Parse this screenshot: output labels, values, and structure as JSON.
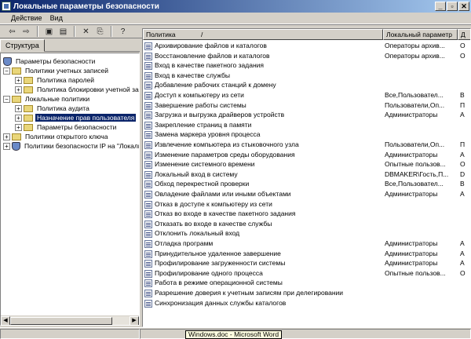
{
  "window": {
    "title": "Локальные параметры безопасности",
    "icon": "mmc-app-icon",
    "buttons": {
      "minimize": "_",
      "restore": "▫",
      "close": "✕"
    }
  },
  "menu": {
    "items": [
      "Действие",
      "Вид"
    ]
  },
  "toolbar": {
    "buttons": [
      {
        "name": "back-icon",
        "glyph": "⇦"
      },
      {
        "name": "forward-icon",
        "glyph": "⇨"
      },
      {
        "name": "up-folder-icon",
        "glyph": "▣"
      },
      {
        "name": "show-tree-icon",
        "glyph": "▤"
      },
      {
        "name": "delete-icon",
        "glyph": "✕"
      },
      {
        "name": "export-list-icon",
        "glyph": "⎘"
      },
      {
        "name": "help-icon",
        "glyph": "?"
      }
    ]
  },
  "left_pane": {
    "tab": "Структура",
    "tree": [
      {
        "label": "Параметры безопасности",
        "level": 0,
        "icon": "security-shield-icon",
        "toggle": ""
      },
      {
        "label": "Политики учетных записей",
        "level": 1,
        "icon": "folder-icon",
        "toggle": "−"
      },
      {
        "label": "Политика паролей",
        "level": 2,
        "icon": "folder-icon",
        "toggle": "+"
      },
      {
        "label": "Политика блокировки учетной зап",
        "level": 2,
        "icon": "folder-icon",
        "toggle": "+"
      },
      {
        "label": "Локальные политики",
        "level": 1,
        "icon": "folder-icon",
        "toggle": "−"
      },
      {
        "label": "Политика аудита",
        "level": 2,
        "icon": "folder-icon",
        "toggle": "+"
      },
      {
        "label": "Назначение прав пользователя",
        "level": 2,
        "icon": "folder-icon",
        "toggle": "+",
        "selected": true
      },
      {
        "label": "Параметры безопасности",
        "level": 2,
        "icon": "folder-icon",
        "toggle": "+"
      },
      {
        "label": "Политики открытого ключа",
        "level": 1,
        "icon": "folder-icon",
        "toggle": "+"
      },
      {
        "label": "Политики безопасности IP на \"Локаль",
        "level": 1,
        "icon": "ip-security-icon",
        "toggle": "+"
      }
    ]
  },
  "list": {
    "columns": [
      "Политика",
      "Локальный параметр",
      "Д"
    ],
    "sort_arrow": "/",
    "rows": [
      [
        "Архивирование файлов и каталогов",
        "Операторы архив...",
        "О"
      ],
      [
        "Восстановление файлов и каталогов",
        "Операторы архив...",
        "О"
      ],
      [
        "Вход в качестве пакетного задания",
        "",
        ""
      ],
      [
        "Вход в качестве службы",
        "",
        ""
      ],
      [
        "Добавление рабочих станций к домену",
        "",
        ""
      ],
      [
        "Доступ к компьютеру из сети",
        "Все,Пользовател...",
        "В"
      ],
      [
        "Завершение работы системы",
        "Пользователи,Оп...",
        "П"
      ],
      [
        "Загрузка и выгрузка драйверов устройств",
        "Администраторы",
        "А"
      ],
      [
        "Закрепление страниц в памяти",
        "",
        ""
      ],
      [
        "Замена маркера уровня процесса",
        "",
        ""
      ],
      [
        "Извлечение компьютера из стыковочного узла",
        "Пользователи,Оп...",
        "П"
      ],
      [
        "Изменение параметров среды оборудования",
        "Администраторы",
        "А"
      ],
      [
        "Изменение системного времени",
        "Опытные пользов...",
        "О"
      ],
      [
        "Локальный вход в систему",
        "DBMAKER\\Гость,П...",
        "D"
      ],
      [
        "Обход перекрестной проверки",
        "Все,Пользовател...",
        "В"
      ],
      [
        "Овладение файлами или иными объектами",
        "Администраторы",
        "А"
      ],
      [
        "Отказ в доступе к компьютеру из сети",
        "",
        ""
      ],
      [
        "Отказ во входе в качестве пакетного задания",
        "",
        ""
      ],
      [
        "Отказать во входе в качестве службы",
        "",
        ""
      ],
      [
        "Отклонить локальный вход",
        "",
        ""
      ],
      [
        "Отладка программ",
        "Администраторы",
        "А"
      ],
      [
        "Принудительное удаленное завершение",
        "Администраторы",
        "А"
      ],
      [
        "Профилирование загруженности системы",
        "Администраторы",
        "А"
      ],
      [
        "Профилирование одного процесса",
        "Опытные пользов...",
        "О"
      ],
      [
        "Работа в режиме операционной системы",
        "",
        ""
      ],
      [
        "Разрешение доверия к учетным записям при делегировании",
        "",
        ""
      ],
      [
        "Синхронизация данных службы каталогов",
        "",
        ""
      ]
    ]
  },
  "status": {
    "tooltip": "Windows.doc - Microsoft Word"
  }
}
